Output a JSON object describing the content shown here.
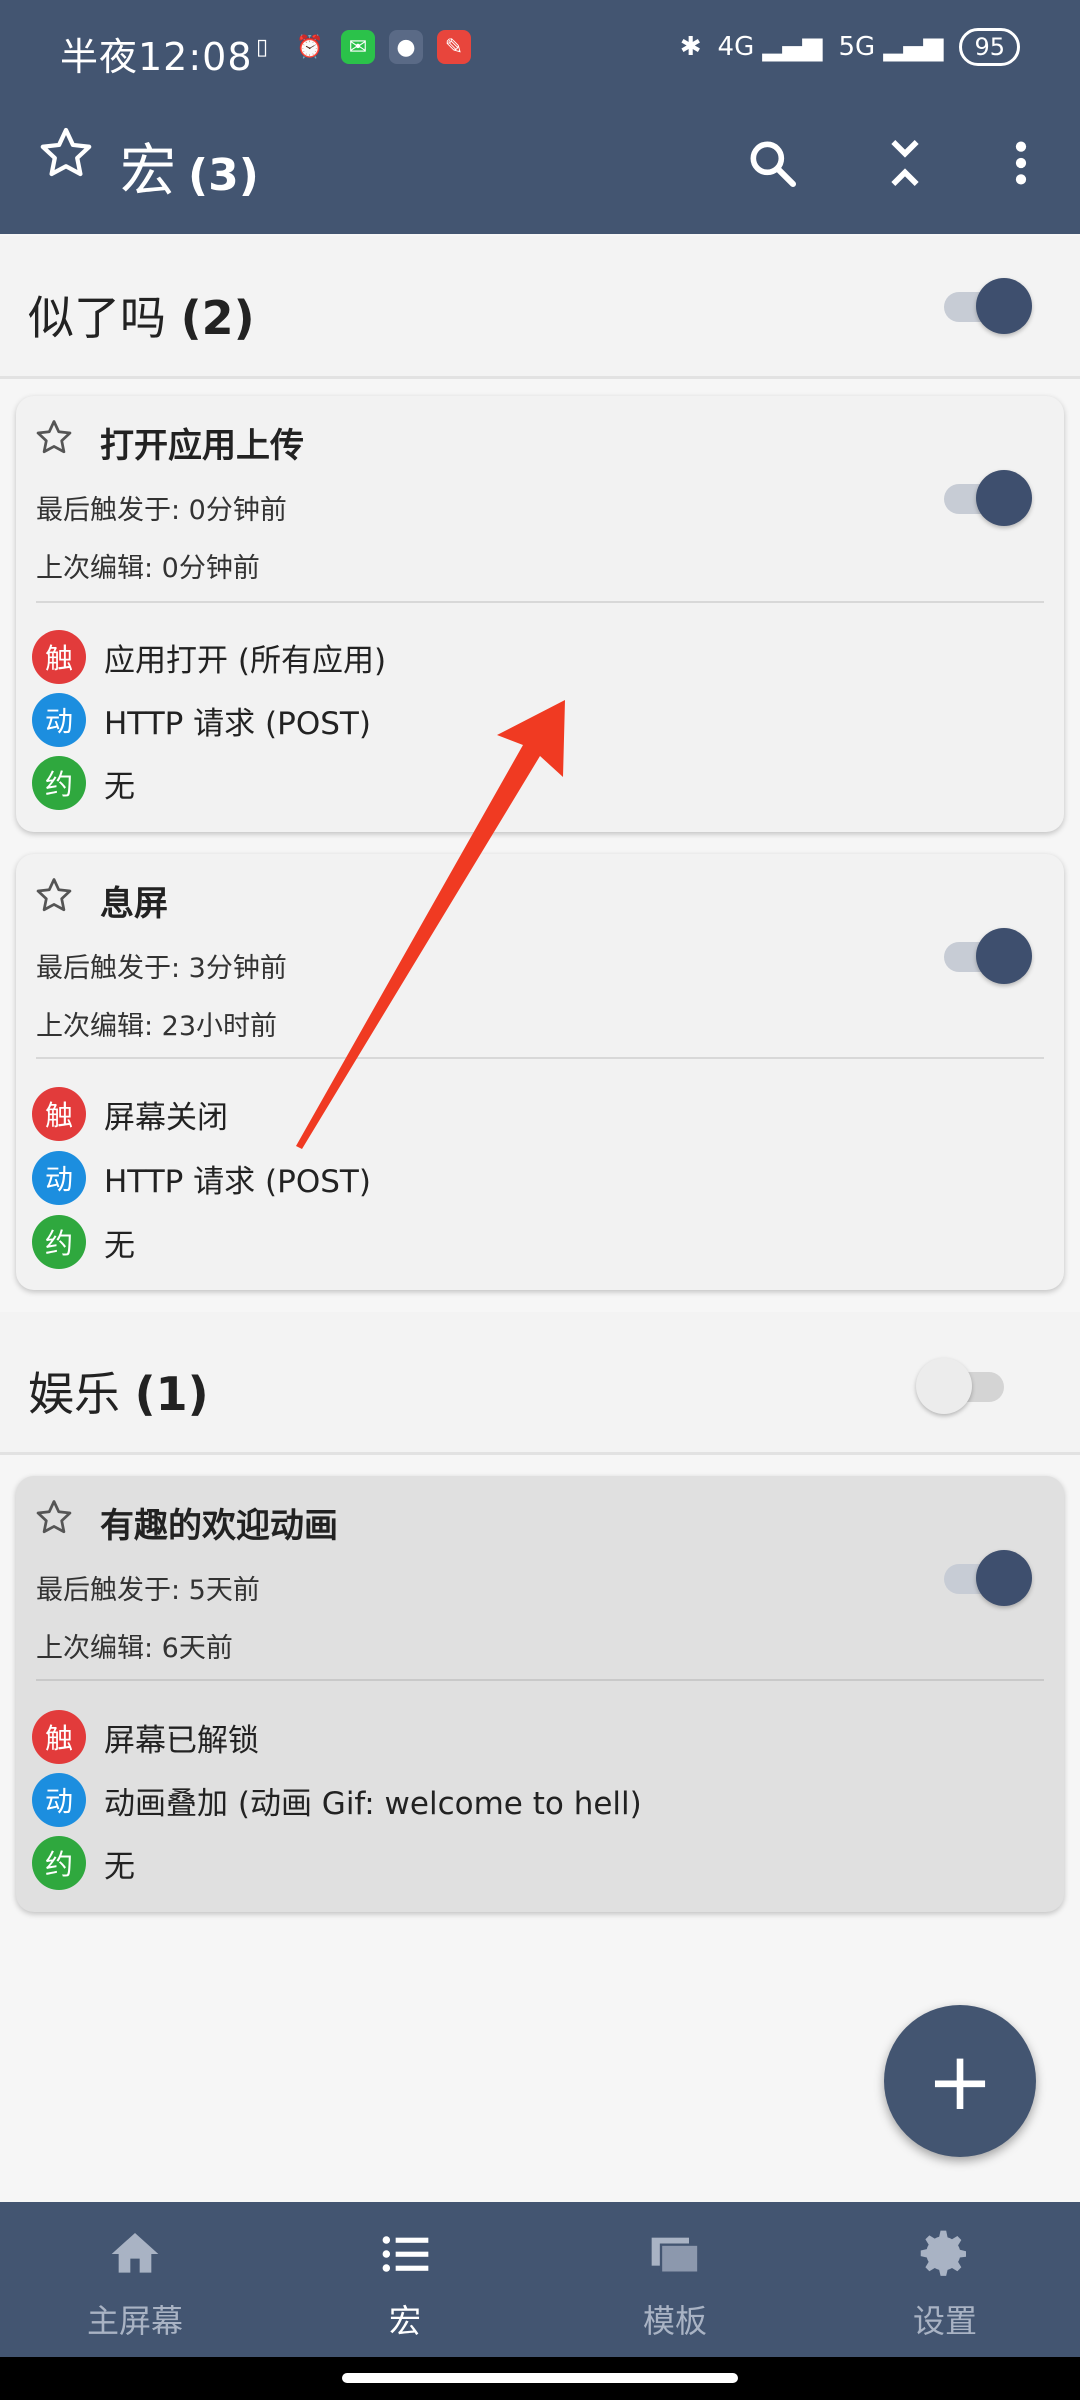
{
  "status": {
    "time": "半夜12:08",
    "battery": "95",
    "net1": "4G",
    "net2": "5G"
  },
  "appbar": {
    "title": "宏",
    "count": "(3)"
  },
  "groups": [
    {
      "name": "似了吗",
      "count": "(2)",
      "enabled": true,
      "macros": [
        {
          "name": "打开应用上传",
          "last_triggered": "最后触发于: 0分钟前",
          "last_edited": "上次编辑: 0分钟前",
          "trigger": "应用打开 (所有应用)",
          "action": "HTTP 请求 (POST)",
          "constraint": "无",
          "enabled": true
        },
        {
          "name": "息屏",
          "last_triggered": "最后触发于: 3分钟前",
          "last_edited": "上次编辑: 23小时前",
          "trigger": "屏幕关闭",
          "action": "HTTP 请求 (POST)",
          "constraint": "无",
          "enabled": true
        }
      ]
    },
    {
      "name": "娱乐",
      "count": "(1)",
      "enabled": false,
      "macros": [
        {
          "name": "有趣的欢迎动画",
          "last_triggered": "最后触发于: 5天前",
          "last_edited": "上次编辑: 6天前",
          "trigger": "屏幕已解锁",
          "action": "动画叠加 (动画 Gif: welcome to hell)",
          "constraint": "无",
          "enabled": true
        }
      ]
    }
  ],
  "badges": {
    "trigger": "触",
    "action": "动",
    "constraint": "约"
  },
  "fab": {
    "label": "+"
  },
  "nav": [
    {
      "label": "主屏幕"
    },
    {
      "label": "宏"
    },
    {
      "label": "模板"
    },
    {
      "label": "设置"
    }
  ],
  "colors": {
    "primary": "#435571",
    "trigger": "#e23b3b",
    "action": "#1c8edf",
    "constraint": "#2fa83e",
    "annotation_arrow": "#f03a22"
  }
}
